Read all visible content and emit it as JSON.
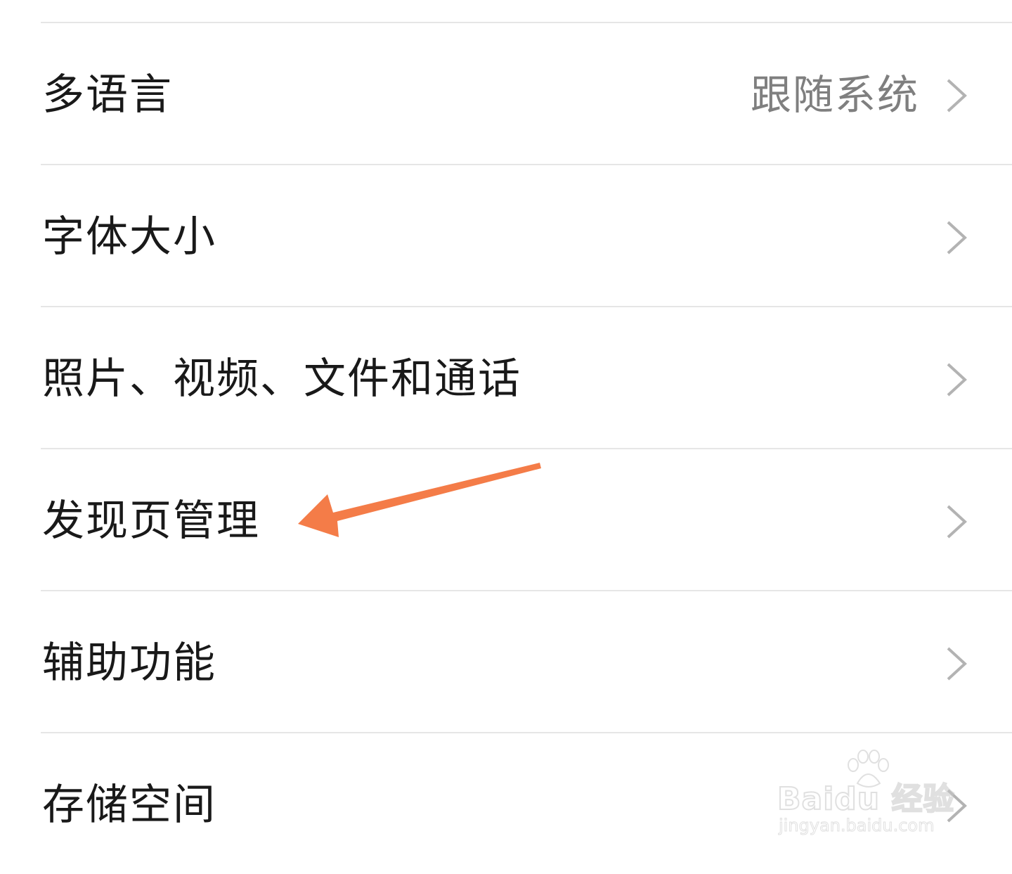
{
  "settings": {
    "items": [
      {
        "label": "多语言",
        "value": "跟随系统"
      },
      {
        "label": "字体大小"
      },
      {
        "label": "照片、视频、文件和通话"
      },
      {
        "label": "发现页管理"
      },
      {
        "label": "辅助功能"
      },
      {
        "label": "存储空间"
      }
    ]
  },
  "annotation": {
    "arrow_color": "#f47c48",
    "target": "发现页管理"
  },
  "watermark": {
    "logo": "Baidu 经验",
    "url": "jingyan.baidu.com"
  },
  "icons": {
    "chevron": "chevron-right-icon"
  },
  "colors": {
    "background": "#ffffff",
    "label": "#191919",
    "value": "#7f7f7f",
    "chevron": "#b3b3b3",
    "divider": "#e6e6e6"
  }
}
